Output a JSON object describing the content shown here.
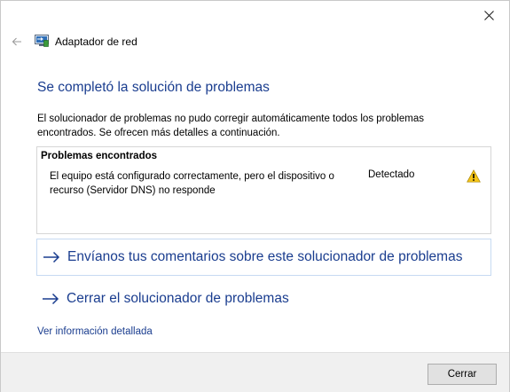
{
  "window": {
    "title": "Adaptador de red",
    "close_glyph": "✕",
    "back_icon": "arrow-left-icon",
    "app_icon": "network-adapter-icon"
  },
  "main": {
    "heading": "Se completó la solución de problemas",
    "description": "El solucionador de problemas no pudo corregir automáticamente todos los problemas encontrados. Se ofrecen más detalles a continuación.",
    "problems": {
      "header": "Problemas encontrados",
      "items": [
        {
          "text": "El equipo está configurado correctamente, pero el dispositivo o recurso (Servidor DNS) no responde",
          "status": "Detectado",
          "icon": "warning-icon"
        }
      ]
    },
    "links": {
      "feedback": "Envíanos tus comentarios sobre este solucionador de problemas",
      "close_troubleshooter": "Cerrar el solucionador de problemas",
      "details": "Ver información detallada"
    }
  },
  "footer": {
    "close_button": "Cerrar"
  },
  "colors": {
    "link_blue": "#1a3d8f",
    "warning_yellow": "#f5c518"
  }
}
